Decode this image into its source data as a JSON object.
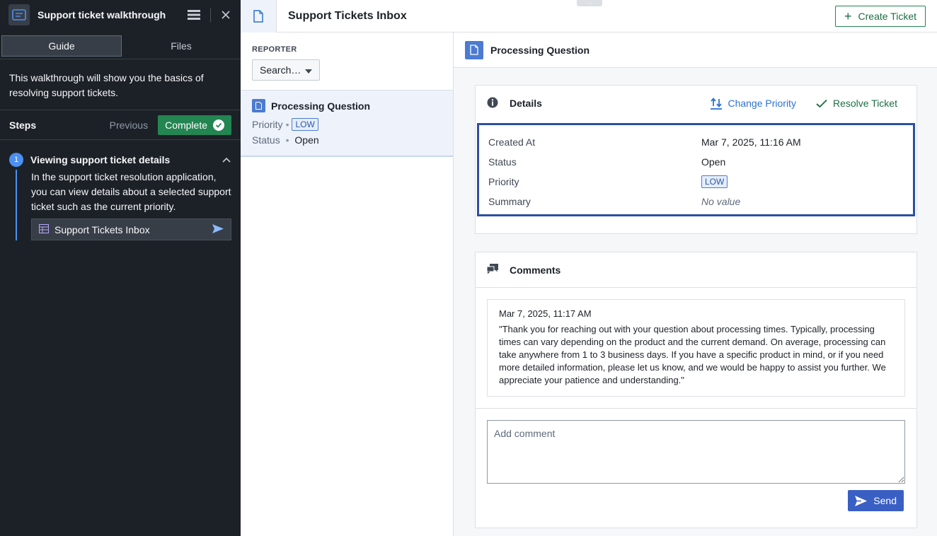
{
  "guide": {
    "title": "Support ticket walkthrough",
    "tabs": [
      {
        "label": "Guide",
        "active": true
      },
      {
        "label": "Files",
        "active": false
      }
    ],
    "intro": "This walkthrough will show you the basics of resolving support tickets.",
    "steps_label": "Steps",
    "previous_label": "Previous",
    "complete_label": "Complete",
    "step": {
      "number": "1",
      "title": "Viewing support ticket details",
      "body": "In the support ticket resolution application, you can view details about a selected support ticket such as the current priority.",
      "link_label": "Support Tickets Inbox"
    }
  },
  "app": {
    "title": "Support Tickets Inbox",
    "create_label": "Create Ticket",
    "handle_dots": "···"
  },
  "list": {
    "filter_label": "REPORTER",
    "filter_value": "Search…",
    "items": [
      {
        "name": "Processing Question",
        "priority_label": "Priority",
        "priority": "LOW",
        "status_label": "Status",
        "status": "Open",
        "sep": "•"
      }
    ]
  },
  "detail": {
    "title": "Processing Question",
    "details": {
      "label": "Details",
      "change_priority": "Change Priority",
      "resolve": "Resolve Ticket",
      "rows": [
        {
          "key": "Created At",
          "value": "Mar 7, 2025, 11:16 AM"
        },
        {
          "key": "Status",
          "value": "Open"
        },
        {
          "key": "Priority",
          "value": "LOW"
        },
        {
          "key": "Summary",
          "value": "No value"
        }
      ]
    },
    "comments": {
      "label": "Comments",
      "items": [
        {
          "timestamp": "Mar 7, 2025, 11:17 AM",
          "text": "\"Thank you for reaching out with your question about processing times. Typically, processing times can vary depending on the product and the current demand. On average, processing can take anywhere from 1 to 3 business days. If you have a specific product in mind, or if you need more detailed information, please let us know, and we would be happy to assist you further. We appreciate your patience and understanding.\""
        }
      ],
      "placeholder": "Add comment",
      "send_label": "Send"
    }
  },
  "colors": {
    "guide_bg": "#1c2127",
    "accent_blue": "#2d72d2",
    "success_green": "#238551",
    "highlight_border": "#2d4fa3"
  },
  "icons": [
    "guide-logo-icon",
    "menu-icon",
    "close-icon",
    "check-circle-icon",
    "chevron-up-icon",
    "table-icon",
    "send-arrow-icon",
    "document-icon",
    "plus-icon",
    "caret-down-icon",
    "info-icon",
    "swap-vertical-icon",
    "check-icon",
    "comments-icon",
    "send-icon"
  ]
}
